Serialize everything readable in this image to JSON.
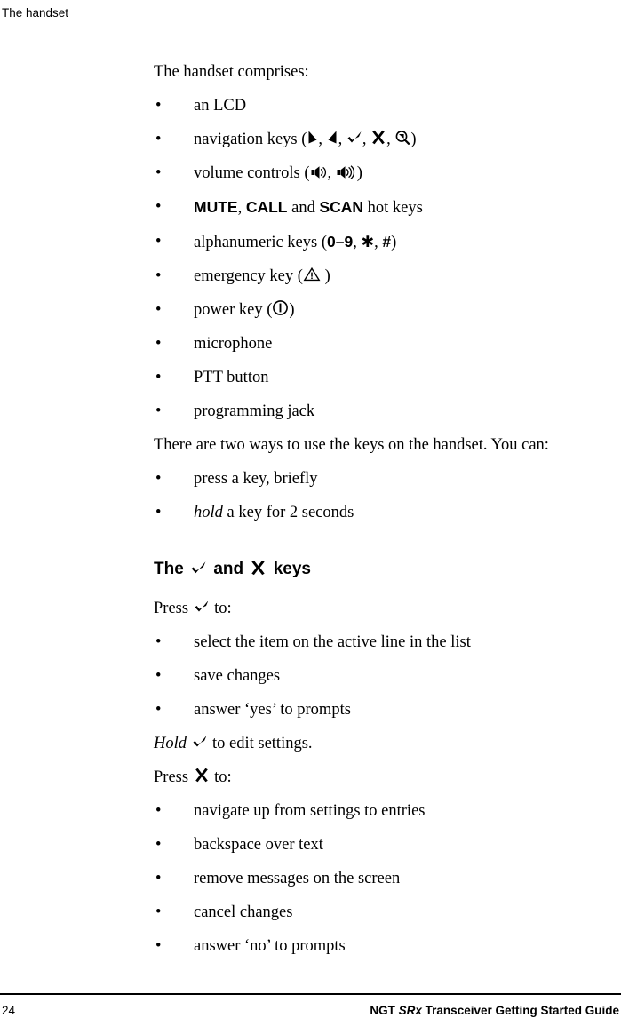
{
  "header": {
    "running_head": "The handset"
  },
  "content": {
    "intro_paragraph": "The handset comprises:",
    "components": [
      {
        "text_before": "an LCD",
        "icons": [],
        "text_after": ""
      },
      {
        "text_before": "navigation keys (",
        "icons": [
          "pointer-right-icon",
          "pointer-left-icon",
          "check-icon",
          "cross-icon",
          "magnifier-icon"
        ],
        "text_after": ")"
      },
      {
        "text_before": "volume controls (",
        "icons": [
          "volume-low-icon",
          "volume-high-icon"
        ],
        "text_after": ")"
      },
      {
        "text_before": "",
        "hot_keys": [
          "MUTE",
          "CALL",
          "SCAN"
        ],
        "conjunction": "and",
        "text_after": "hot keys"
      },
      {
        "text_before": "alphanumeric keys (",
        "keys": [
          "0–9",
          "✱",
          "#"
        ],
        "text_after": ")"
      },
      {
        "text_before": "emergency key (",
        "icons": [
          "warning-triangle-icon"
        ],
        "text_after": ")"
      },
      {
        "text_before": "power key (",
        "icons": [
          "power-icon"
        ],
        "text_after": ")"
      },
      {
        "text_before": "microphone",
        "icons": [],
        "text_after": ""
      },
      {
        "text_before": "PTT button",
        "icons": [],
        "text_after": ""
      },
      {
        "text_before": "programming jack",
        "icons": [],
        "text_after": ""
      }
    ],
    "labels": {
      "an_lcd": "an LCD",
      "navigation_keys_open": "navigation keys (",
      "paren_close": ")",
      "volume_controls_open": "volume controls (",
      "mute": "MUTE",
      "call": "CALL",
      "scan": "SCAN",
      "comma": ", ",
      "and": " and ",
      "hot_keys": " hot keys",
      "alphanumeric_open": "alphanumeric keys (",
      "digits": "0–9",
      "star": "✱",
      "hash": "#",
      "emergency_open": "emergency key (",
      "power_open": "power key (",
      "microphone": "microphone",
      "ptt_button": "PTT button",
      "programming_jack": "programming jack"
    },
    "ways_paragraph": "There are two ways to use the keys on the handset. You can:",
    "ways": [
      {
        "lead": "",
        "lead_italic": "",
        "text": "press a key, briefly"
      },
      {
        "lead_italic": "hold",
        "text": " a key for 2 seconds"
      }
    ],
    "ways_labels": {
      "press_briefly": "press a key, briefly",
      "hold": "hold",
      "hold_rest": " a key for 2 seconds"
    },
    "section": {
      "heading_the": "The",
      "heading_and": "and",
      "heading_keys": "keys",
      "heading_icons": [
        "check-icon",
        "cross-icon"
      ],
      "press_check_lead": "Press",
      "press_check_trail": "to:",
      "check_actions": [
        "select the item on the active line in the list",
        "save changes",
        "answer ‘yes’ to prompts"
      ],
      "hold_line_italic": "Hold",
      "hold_line_trail": "to edit settings.",
      "press_cross_lead": "Press",
      "press_cross_trail": "to:",
      "cross_actions": [
        "navigate up from settings to entries",
        "backspace over text",
        "remove messages on the screen",
        "cancel changes",
        "answer ‘no’ to prompts"
      ]
    },
    "bullet_glyph": "•"
  },
  "footer": {
    "page_number": "24",
    "guide_title_pre": "NGT ",
    "guide_title_italic": "SRx",
    "guide_title_post": " Transceiver Getting Started Guide"
  },
  "colors": {
    "text": "#000000",
    "background": "#ffffff",
    "rule": "#000000"
  }
}
